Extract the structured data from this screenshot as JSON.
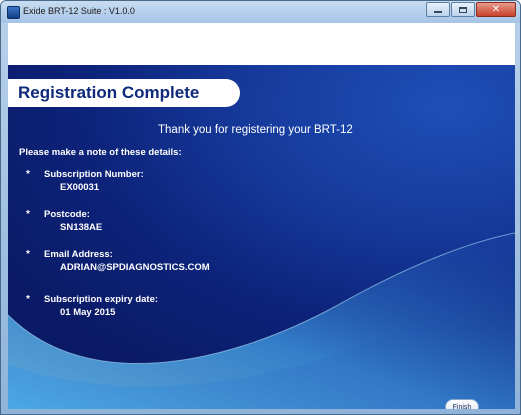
{
  "window": {
    "title": "Exide BRT-12 Suite : V1.0.0"
  },
  "header": {
    "title": "Registration Complete"
  },
  "message": {
    "thanks": "Thank you for registering your BRT-12",
    "note": "Please make a note of these details:"
  },
  "details": [
    {
      "label": "Subscription Number:",
      "value": "EX00031"
    },
    {
      "label": "Postcode:",
      "value": "SN138AE"
    },
    {
      "label": "Email Address:",
      "value": "ADRIAN@SPDIAGNOSTICS.COM"
    },
    {
      "label": "Subscription expiry date:",
      "value": "01 May 2015"
    }
  ],
  "bullet": "*",
  "buttons": {
    "finish": "Finish"
  },
  "colors": {
    "panel_blue": "#15399a",
    "header_text": "#0f2a7a",
    "accent_light": "#5ab6e8"
  }
}
